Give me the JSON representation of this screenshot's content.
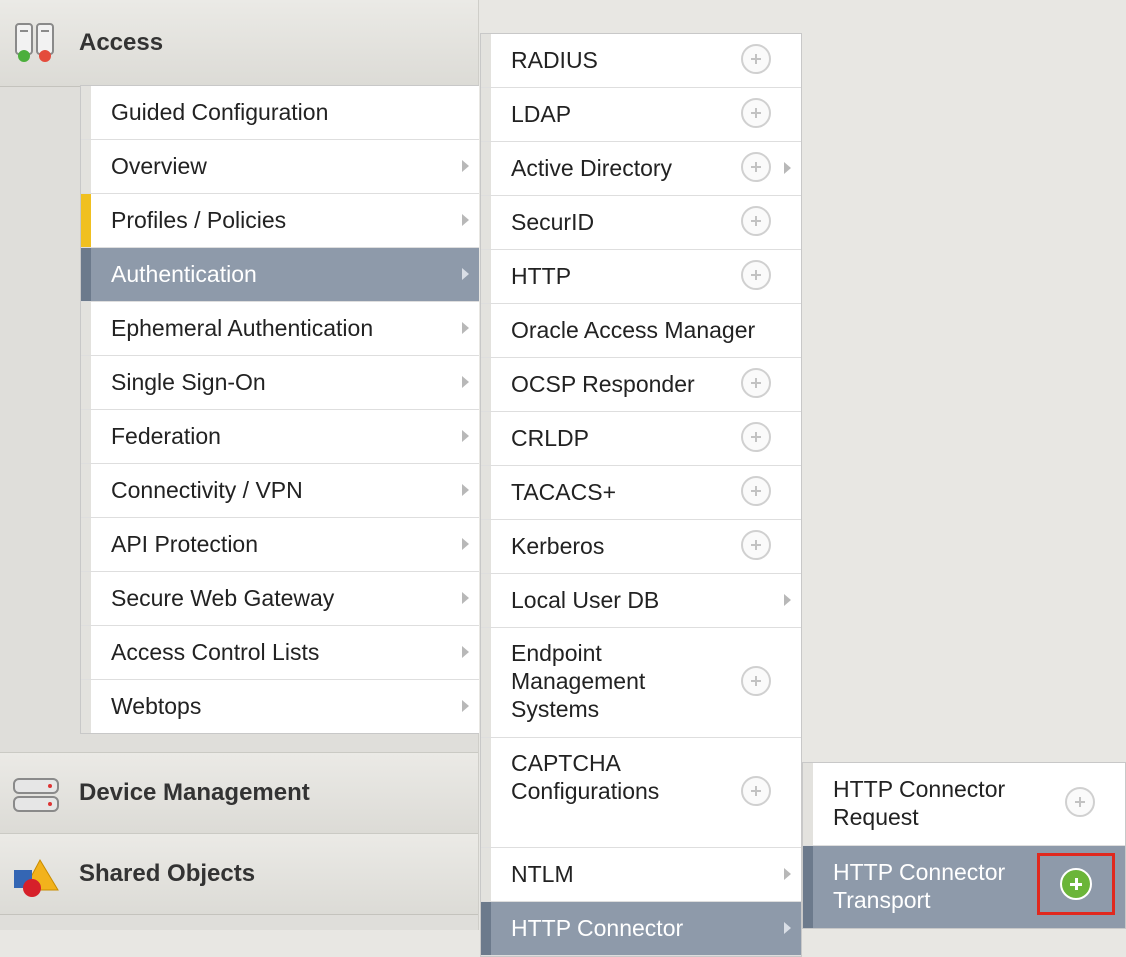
{
  "sections": {
    "access": {
      "label": "Access",
      "icon": "access-icon"
    },
    "device": {
      "label": "Device Management",
      "icon": "server-icon"
    },
    "shared": {
      "label": "Shared Objects",
      "icon": "shapes-icon"
    }
  },
  "menu1": [
    {
      "label": "Guided Configuration",
      "arrow": false
    },
    {
      "label": "Overview",
      "arrow": true
    },
    {
      "label": "Profiles / Policies",
      "arrow": true,
      "marked": true
    },
    {
      "label": "Authentication",
      "arrow": true,
      "active": true
    },
    {
      "label": "Ephemeral Authentication",
      "arrow": true
    },
    {
      "label": "Single Sign-On",
      "arrow": true
    },
    {
      "label": "Federation",
      "arrow": true
    },
    {
      "label": "Connectivity / VPN",
      "arrow": true
    },
    {
      "label": "API Protection",
      "arrow": true
    },
    {
      "label": "Secure Web Gateway",
      "arrow": true
    },
    {
      "label": "Access Control Lists",
      "arrow": true
    },
    {
      "label": "Webtops",
      "arrow": true
    }
  ],
  "menu2": [
    {
      "label": "RADIUS",
      "plus": true
    },
    {
      "label": "LDAP",
      "plus": true
    },
    {
      "label": "Active Directory",
      "plus": true,
      "arrow": true
    },
    {
      "label": "SecurID",
      "plus": true
    },
    {
      "label": "HTTP",
      "plus": true
    },
    {
      "label": "Oracle Access Manager"
    },
    {
      "label": "OCSP Responder",
      "plus": true
    },
    {
      "label": "CRLDP",
      "plus": true
    },
    {
      "label": "TACACS+",
      "plus": true
    },
    {
      "label": "Kerberos",
      "plus": true
    },
    {
      "label": "Local User DB",
      "arrow": true
    },
    {
      "label": "Endpoint Management Systems",
      "plus": true,
      "tall": true
    },
    {
      "label": "CAPTCHA Configurations",
      "plus": true,
      "tall": true
    },
    {
      "label": "NTLM",
      "arrow": true
    },
    {
      "label": "HTTP Connector",
      "arrow": true,
      "active": true
    }
  ],
  "menu3": [
    {
      "label": "HTTP Connector Request"
    },
    {
      "label": "HTTP Connector Transport",
      "active": true
    }
  ],
  "colors": {
    "active": "#8e9aaa",
    "marker": "#f0c020",
    "highlight": "#e0281e",
    "add": "#6bb539"
  }
}
